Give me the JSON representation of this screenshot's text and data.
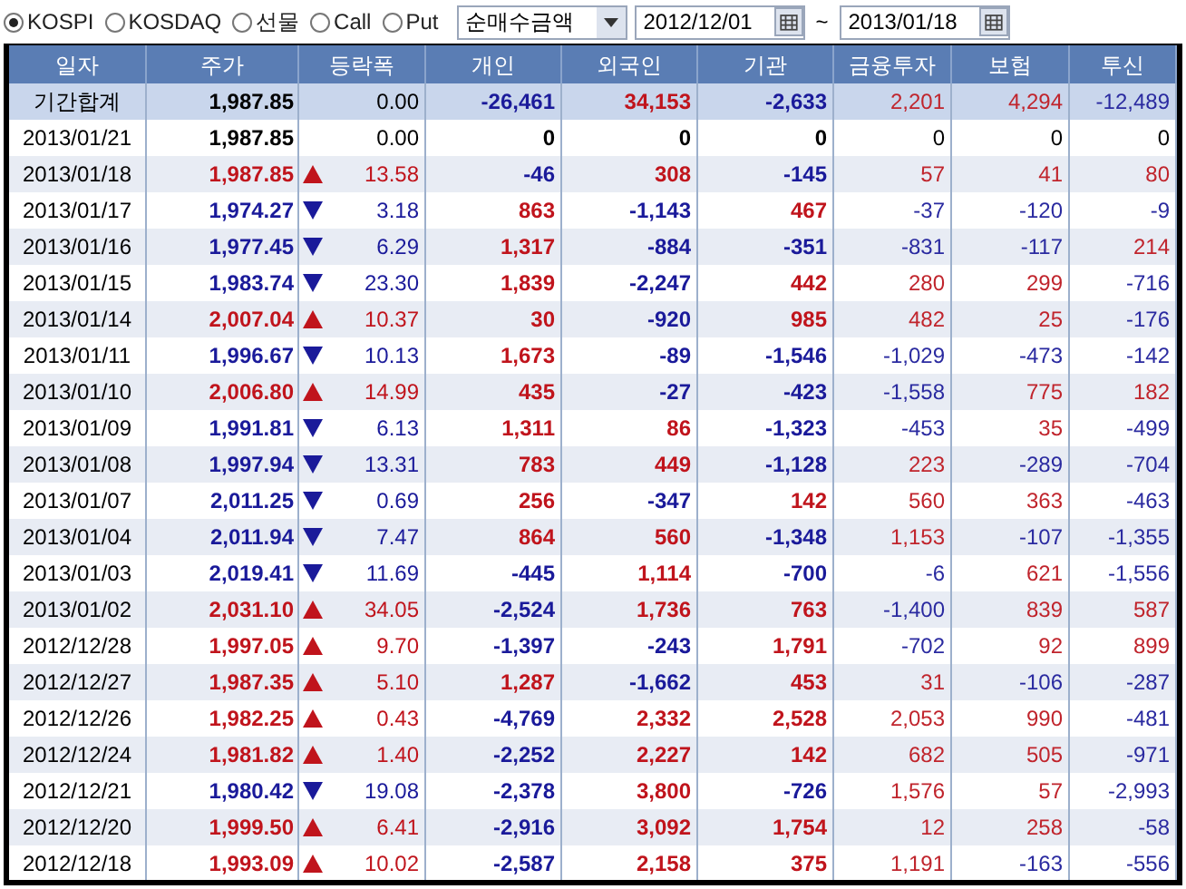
{
  "markets": [
    {
      "label": "KOSPI",
      "selected": true
    },
    {
      "label": "KOSDAQ",
      "selected": false
    },
    {
      "label": "선물",
      "selected": false
    },
    {
      "label": "Call",
      "selected": false
    },
    {
      "label": "Put",
      "selected": false
    }
  ],
  "mode_select": {
    "value": "순매수금액"
  },
  "date_from": {
    "value": "2012/12/01"
  },
  "range_separator": "~",
  "date_to": {
    "value": "2013/01/18"
  },
  "table": {
    "columns": [
      "일자",
      "주가",
      "등락폭",
      "개인",
      "외국인",
      "기관",
      "금융투자",
      "보험",
      "투신"
    ],
    "rows": [
      {
        "kind": "summary",
        "up": false,
        "down": false,
        "cells": [
          "기간합계",
          "1,987.85",
          "0.00",
          "-26,461",
          "34,153",
          "-2,633",
          "2,201",
          "4,294",
          "-12,489"
        ]
      },
      {
        "kind": "day",
        "up": false,
        "down": false,
        "cells": [
          "2013/01/21",
          "1,987.85",
          "0.00",
          "0",
          "0",
          "0",
          "0",
          "0",
          "0"
        ]
      },
      {
        "kind": "day",
        "up": true,
        "down": false,
        "cells": [
          "2013/01/18",
          "1,987.85",
          "13.58",
          "-46",
          "308",
          "-145",
          "57",
          "41",
          "80"
        ]
      },
      {
        "kind": "day",
        "up": false,
        "down": true,
        "cells": [
          "2013/01/17",
          "1,974.27",
          "3.18",
          "863",
          "-1,143",
          "467",
          "-37",
          "-120",
          "-9"
        ]
      },
      {
        "kind": "day",
        "up": false,
        "down": true,
        "cells": [
          "2013/01/16",
          "1,977.45",
          "6.29",
          "1,317",
          "-884",
          "-351",
          "-831",
          "-117",
          "214"
        ]
      },
      {
        "kind": "day",
        "up": false,
        "down": true,
        "cells": [
          "2013/01/15",
          "1,983.74",
          "23.30",
          "1,839",
          "-2,247",
          "442",
          "280",
          "299",
          "-716"
        ]
      },
      {
        "kind": "day",
        "up": true,
        "down": false,
        "cells": [
          "2013/01/14",
          "2,007.04",
          "10.37",
          "30",
          "-920",
          "985",
          "482",
          "25",
          "-176"
        ]
      },
      {
        "kind": "day",
        "up": false,
        "down": true,
        "cells": [
          "2013/01/11",
          "1,996.67",
          "10.13",
          "1,673",
          "-89",
          "-1,546",
          "-1,029",
          "-473",
          "-142"
        ]
      },
      {
        "kind": "day",
        "up": true,
        "down": false,
        "cells": [
          "2013/01/10",
          "2,006.80",
          "14.99",
          "435",
          "-27",
          "-423",
          "-1,558",
          "775",
          "182"
        ]
      },
      {
        "kind": "day",
        "up": false,
        "down": true,
        "cells": [
          "2013/01/09",
          "1,991.81",
          "6.13",
          "1,311",
          "86",
          "-1,323",
          "-453",
          "35",
          "-499"
        ]
      },
      {
        "kind": "day",
        "up": false,
        "down": true,
        "cells": [
          "2013/01/08",
          "1,997.94",
          "13.31",
          "783",
          "449",
          "-1,128",
          "223",
          "-289",
          "-704"
        ]
      },
      {
        "kind": "day",
        "up": false,
        "down": true,
        "cells": [
          "2013/01/07",
          "2,011.25",
          "0.69",
          "256",
          "-347",
          "142",
          "560",
          "363",
          "-463"
        ]
      },
      {
        "kind": "day",
        "up": false,
        "down": true,
        "cells": [
          "2013/01/04",
          "2,011.94",
          "7.47",
          "864",
          "560",
          "-1,348",
          "1,153",
          "-107",
          "-1,355"
        ]
      },
      {
        "kind": "day",
        "up": false,
        "down": true,
        "cells": [
          "2013/01/03",
          "2,019.41",
          "11.69",
          "-445",
          "1,114",
          "-700",
          "-6",
          "621",
          "-1,556"
        ]
      },
      {
        "kind": "day",
        "up": true,
        "down": false,
        "cells": [
          "2013/01/02",
          "2,031.10",
          "34.05",
          "-2,524",
          "1,736",
          "763",
          "-1,400",
          "839",
          "587"
        ]
      },
      {
        "kind": "day",
        "up": true,
        "down": false,
        "cells": [
          "2012/12/28",
          "1,997.05",
          "9.70",
          "-1,397",
          "-243",
          "1,791",
          "-702",
          "92",
          "899"
        ]
      },
      {
        "kind": "day",
        "up": true,
        "down": false,
        "cells": [
          "2012/12/27",
          "1,987.35",
          "5.10",
          "1,287",
          "-1,662",
          "453",
          "31",
          "-106",
          "-287"
        ]
      },
      {
        "kind": "day",
        "up": true,
        "down": false,
        "cells": [
          "2012/12/26",
          "1,982.25",
          "0.43",
          "-4,769",
          "2,332",
          "2,528",
          "2,053",
          "990",
          "-481"
        ]
      },
      {
        "kind": "day",
        "up": true,
        "down": false,
        "cells": [
          "2012/12/24",
          "1,981.82",
          "1.40",
          "-2,252",
          "2,227",
          "142",
          "682",
          "505",
          "-971"
        ]
      },
      {
        "kind": "day",
        "up": false,
        "down": true,
        "cells": [
          "2012/12/21",
          "1,980.42",
          "19.08",
          "-2,378",
          "3,800",
          "-726",
          "1,576",
          "57",
          "-2,993"
        ]
      },
      {
        "kind": "day",
        "up": true,
        "down": false,
        "cells": [
          "2012/12/20",
          "1,999.50",
          "6.41",
          "-2,916",
          "3,092",
          "1,754",
          "12",
          "258",
          "-58"
        ]
      },
      {
        "kind": "day",
        "up": true,
        "down": false,
        "cells": [
          "2012/12/18",
          "1,993.09",
          "10.02",
          "-2,587",
          "2,158",
          "375",
          "1,191",
          "-163",
          "-556"
        ]
      }
    ]
  }
}
